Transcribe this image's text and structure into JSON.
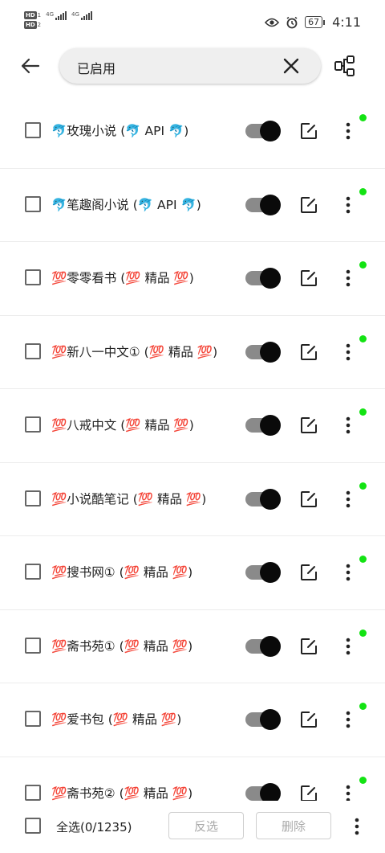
{
  "status_bar": {
    "hd1": "HD",
    "hd2": "HD",
    "net1": "4G",
    "net2": "4G",
    "battery": "67",
    "time": "4:11"
  },
  "search": {
    "query": "已启用"
  },
  "sources": [
    {
      "label": "🐬玫瑰小说 (🐬 API 🐬)"
    },
    {
      "label": "🐬笔趣阁小说 (🐬 API 🐬)"
    },
    {
      "label": "💯零零看书 (💯 精品 💯)"
    },
    {
      "label": "💯新八一中文① (💯 精品 💯)"
    },
    {
      "label": "💯八戒中文 (💯 精品 💯)"
    },
    {
      "label": "💯小说酷笔记 (💯 精品 💯)"
    },
    {
      "label": "💯搜书网① (💯 精品 💯)"
    },
    {
      "label": "💯斋书苑① (💯 精品 💯)"
    },
    {
      "label": "💯爱书包 (💯 精品 💯)"
    },
    {
      "label": "💯斋书苑② (💯 精品 💯)"
    }
  ],
  "bottom": {
    "select_all": "全选(0/1235)",
    "invert": "反选",
    "delete": "删除"
  },
  "colors": {
    "enabled_dot": "#13e313",
    "toggle_thumb": "#0a0a0a",
    "toggle_track": "#8a8a8a"
  }
}
